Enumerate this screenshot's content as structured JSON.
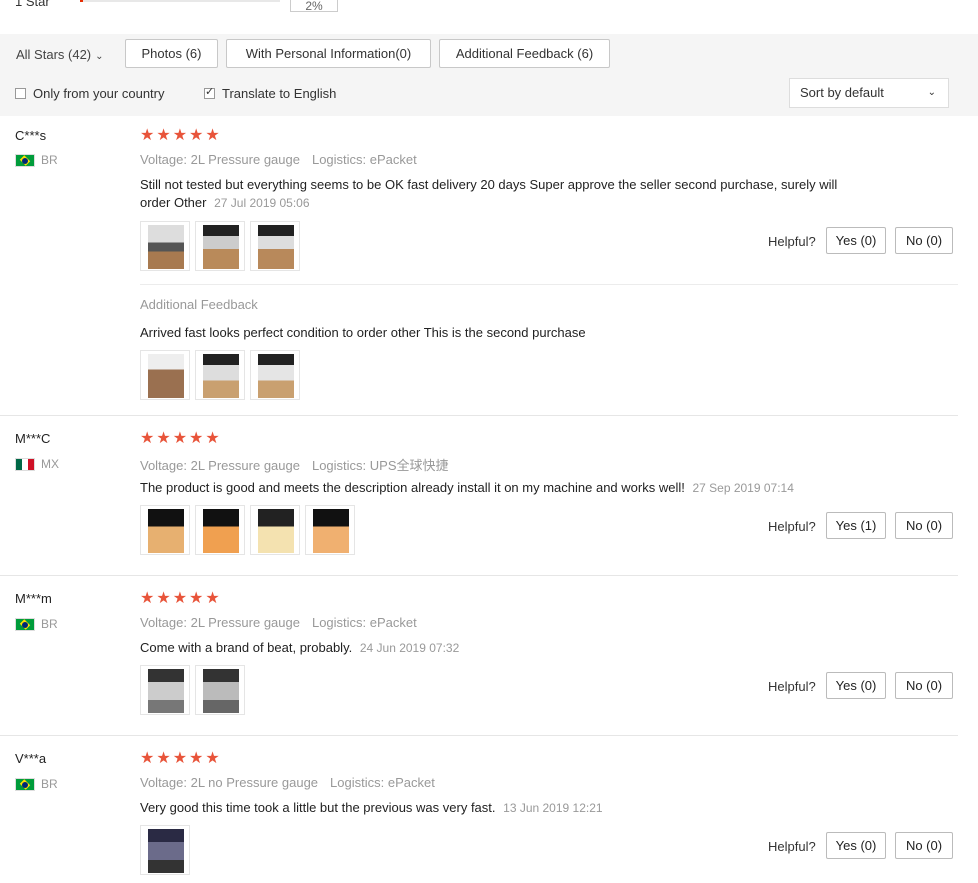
{
  "top_summary": {
    "star_label": "1 Star",
    "percent": "2%"
  },
  "filters": {
    "all_stars": "All Stars (42)",
    "photos": "Photos (6)",
    "personal_info": "With Personal Information(0)",
    "additional_feedback": "Additional Feedback (6)",
    "only_country": "Only from your country",
    "only_country_checked": false,
    "translate": "Translate to English",
    "translate_checked": true,
    "sort": "Sort by default"
  },
  "helpful_label": "Helpful?",
  "stars_glyph": "★★★★★",
  "reviews": [
    {
      "user": "C***s",
      "country": "BR",
      "rating": 5,
      "voltage": "Voltage: 2L Pressure gauge",
      "logistics": "Logistics: ePacket",
      "text": "Still not tested but everything seems to be OK fast delivery 20 days Super approve the seller second purchase, surely will order Other",
      "date": "27 Jul 2019 05:06",
      "photos": 3,
      "yes": "Yes (0)",
      "no": "No (0)",
      "additional": {
        "title": "Additional Feedback",
        "text": "Arrived fast looks perfect condition to order other This is the second purchase",
        "photos": 3
      }
    },
    {
      "user": "M***C",
      "country": "MX",
      "rating": 5,
      "voltage": "Voltage: 2L Pressure gauge",
      "logistics": "Logistics: UPS全球快捷",
      "text": "The product is good and meets the description already install it on my machine and works well!",
      "date": "27 Sep 2019 07:14",
      "photos": 4,
      "yes": "Yes (1)",
      "no": "No (0)"
    },
    {
      "user": "M***m",
      "country": "BR",
      "rating": 5,
      "voltage": "Voltage: 2L Pressure gauge",
      "logistics": "Logistics: ePacket",
      "text": "Come with a brand of beat, probably.",
      "date": "24 Jun 2019 07:32",
      "photos": 2,
      "yes": "Yes (0)",
      "no": "No (0)"
    },
    {
      "user": "V***a",
      "country": "BR",
      "rating": 5,
      "voltage": "Voltage: 2L no Pressure gauge",
      "logistics": "Logistics: ePacket",
      "text": "Very good this time took a little but the previous was very fast.",
      "date": "13 Jun 2019 12:21",
      "photos": 1,
      "yes": "Yes (0)",
      "no": "No (0)"
    }
  ]
}
